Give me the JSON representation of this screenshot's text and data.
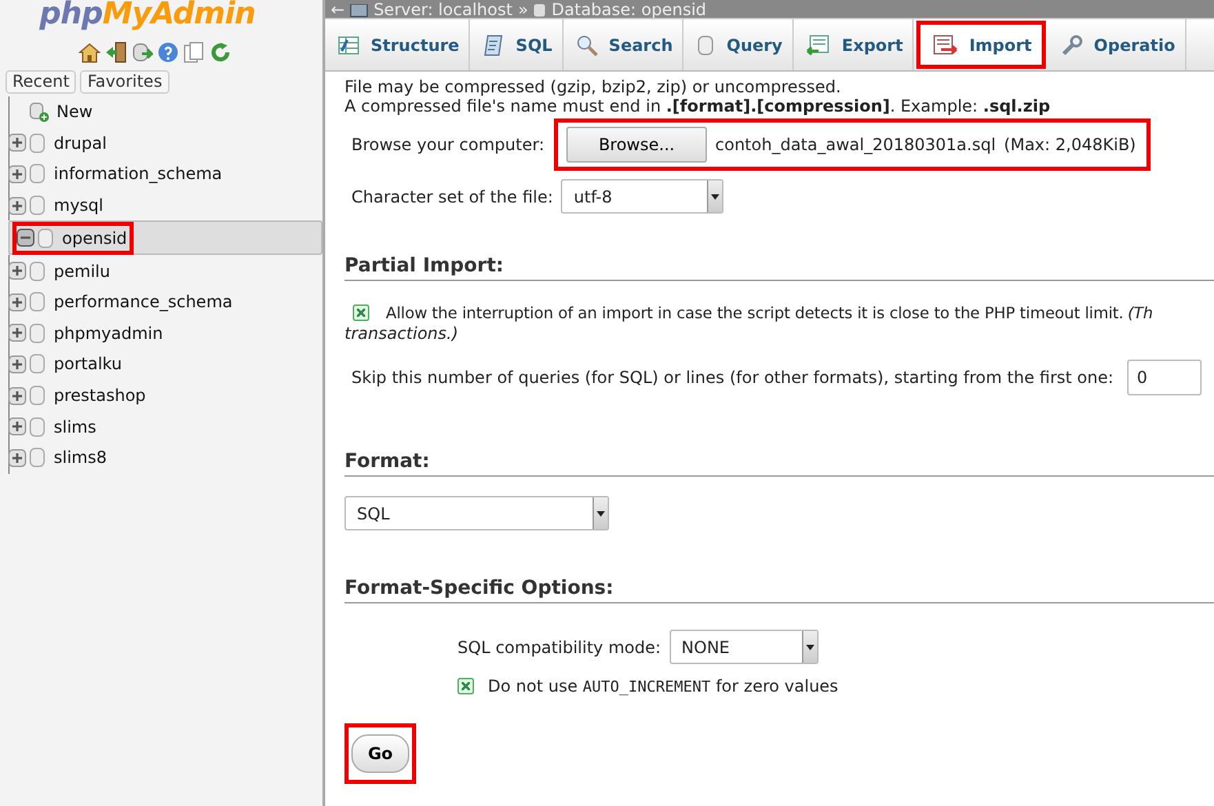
{
  "logo": {
    "part_1": "php",
    "part_2": "MyAdmin"
  },
  "sidebar": {
    "tabs": [
      {
        "label": "Recent"
      },
      {
        "label": "Favorites"
      }
    ],
    "tree": [
      {
        "name": "New",
        "kind": "new",
        "selected": false,
        "highlighted": false
      },
      {
        "name": "drupal",
        "kind": "db",
        "expanded": false,
        "selected": false,
        "highlighted": false
      },
      {
        "name": "information_schema",
        "kind": "db",
        "expanded": false,
        "selected": false,
        "highlighted": false
      },
      {
        "name": "mysql",
        "kind": "db",
        "expanded": false,
        "selected": false,
        "highlighted": false
      },
      {
        "name": "opensid",
        "kind": "db",
        "expanded": true,
        "selected": true,
        "highlighted": true
      },
      {
        "name": "pemilu",
        "kind": "db",
        "expanded": false,
        "selected": false,
        "highlighted": false
      },
      {
        "name": "performance_schema",
        "kind": "db",
        "expanded": false,
        "selected": false,
        "highlighted": false
      },
      {
        "name": "phpmyadmin",
        "kind": "db",
        "expanded": false,
        "selected": false,
        "highlighted": false
      },
      {
        "name": "portalku",
        "kind": "db",
        "expanded": false,
        "selected": false,
        "highlighted": false
      },
      {
        "name": "prestashop",
        "kind": "db",
        "expanded": false,
        "selected": false,
        "highlighted": false
      },
      {
        "name": "slims",
        "kind": "db",
        "expanded": false,
        "selected": false,
        "highlighted": false
      },
      {
        "name": "slims8",
        "kind": "db",
        "expanded": false,
        "selected": false,
        "highlighted": false
      }
    ]
  },
  "breadcrumb": {
    "back": "←",
    "server": "Server: localhost",
    "separator": "»",
    "database": "Database: opensid"
  },
  "tabs": [
    {
      "label": "Structure",
      "selected": false,
      "highlighted": false
    },
    {
      "label": "SQL",
      "selected": false,
      "highlighted": false
    },
    {
      "label": "Search",
      "selected": false,
      "highlighted": false
    },
    {
      "label": "Query",
      "selected": false,
      "highlighted": false
    },
    {
      "label": "Export",
      "selected": false,
      "highlighted": false
    },
    {
      "label": "Import",
      "selected": true,
      "highlighted": true
    },
    {
      "label": "Operatio",
      "selected": false,
      "highlighted": false
    }
  ],
  "file_section": {
    "note_1": "File may be compressed (gzip, bzip2, zip) or uncompressed.",
    "note_2": "A compressed file's name must end in **.[format].[compression]**. Example: **.sql.zip**",
    "browse_label": "Browse your computer:",
    "browse_button": "Browse...",
    "file_name": "contoh_data_awal_20180301a.sql",
    "max_size": "(Max: 2,048KiB)",
    "highlighted": true,
    "charset_label": "Character set of the file:",
    "charset_value": "utf-8"
  },
  "partial_import": {
    "heading": "Partial Import:",
    "allow_interrupt": {
      "label": "Allow the interruption of an import in case the script detects it is close to the PHP timeout limit.",
      "note_start": "(Th",
      "note_end": "transactions.)",
      "checked": true
    },
    "skip_label": "Skip this number of queries (for SQL) or lines (for other formats), starting from the first one:",
    "skip_value": "0"
  },
  "format": {
    "heading": "Format:",
    "value": "SQL"
  },
  "format_options": {
    "heading": "Format-Specific Options:",
    "compat_label": "SQL compatibility mode:",
    "compat_value": "NONE",
    "auto_increment": {
      "label_start": "Do not use",
      "code": "AUTO_INCREMENT",
      "label_end": "for zero values",
      "checked": true
    }
  },
  "go_button": {
    "label": "Go",
    "highlighted": true
  }
}
